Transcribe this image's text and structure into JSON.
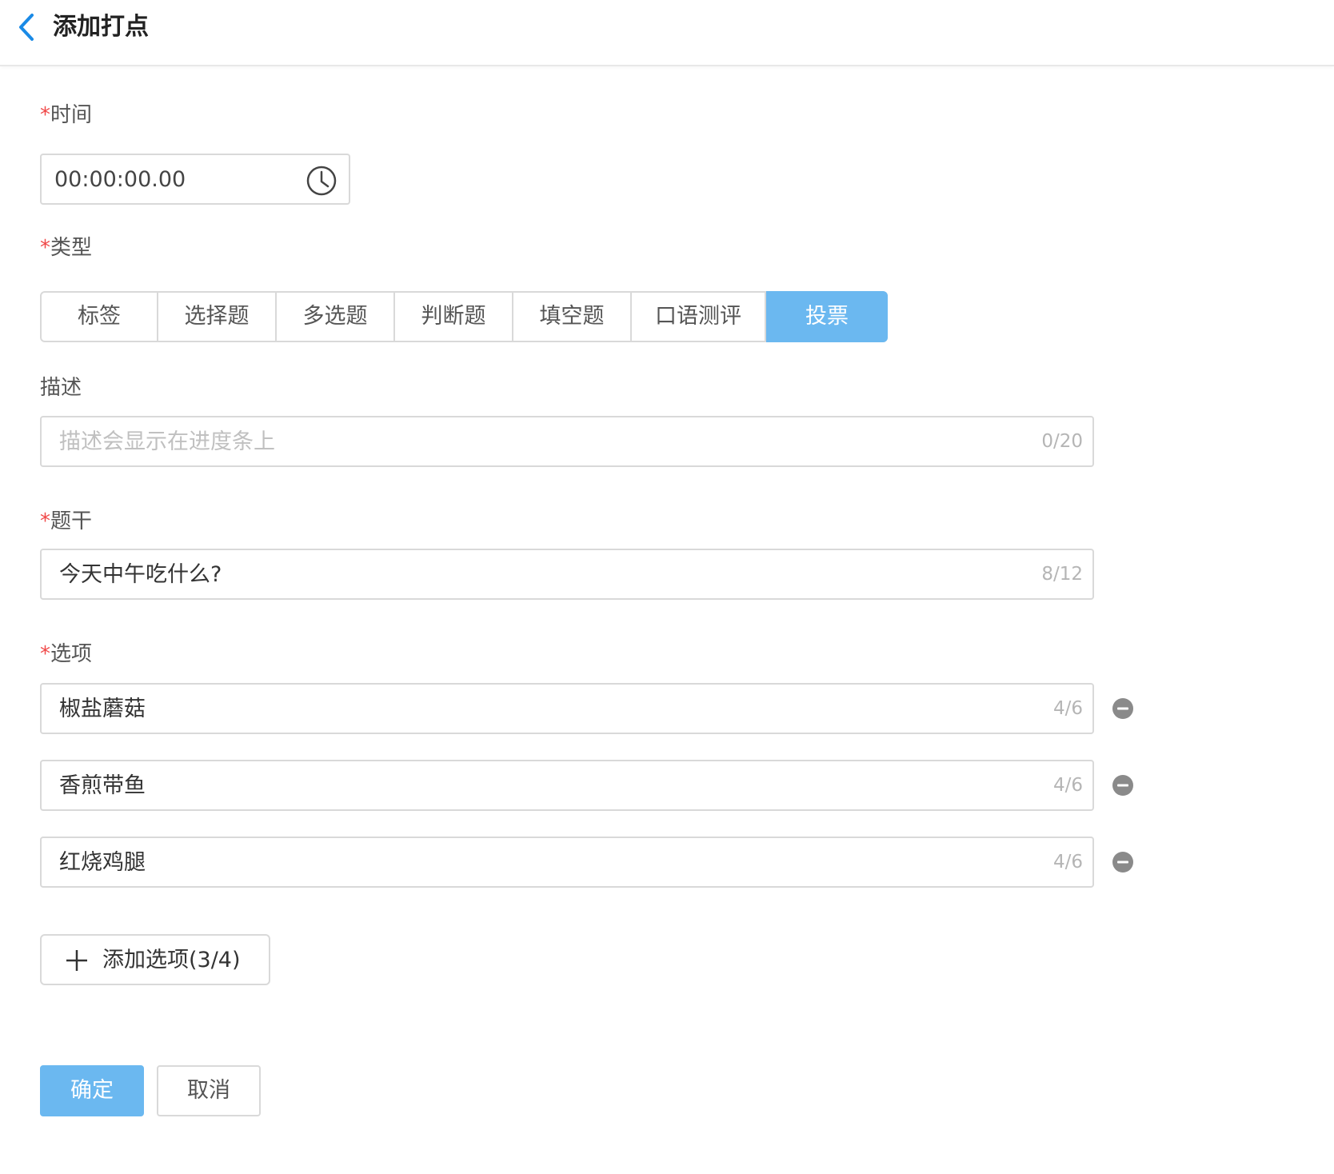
{
  "header": {
    "title": "添加打点"
  },
  "form": {
    "time": {
      "label": "时间",
      "required_mark": "*",
      "value": "00:00:00.00"
    },
    "type": {
      "label": "类型",
      "required_mark": "*",
      "options": [
        "标签",
        "选择题",
        "多选题",
        "判断题",
        "填空题",
        "口语测评",
        "投票"
      ],
      "selected": "投票"
    },
    "description": {
      "label": "描述",
      "placeholder": "描述会显示在进度条上",
      "counter": "0/20"
    },
    "stem": {
      "label": "题干",
      "required_mark": "*",
      "value": "今天中午吃什么?",
      "counter": "8/12"
    },
    "options": {
      "label": "选项",
      "required_mark": "*",
      "items": [
        {
          "value": "椒盐蘑菇",
          "counter": "4/6"
        },
        {
          "value": "香煎带鱼",
          "counter": "4/6"
        },
        {
          "value": "红烧鸡腿",
          "counter": "4/6"
        }
      ],
      "add_label": "添加选项(3/4)"
    }
  },
  "actions": {
    "confirm": "确定",
    "cancel": "取消"
  },
  "colors": {
    "accent": "#6bb8f0",
    "back_arrow": "#1a8ae6",
    "required": "#f04848"
  },
  "icons": {
    "back": "chevron-left-icon",
    "clock": "clock-icon",
    "remove": "minus-circle-icon",
    "add": "plus-icon"
  }
}
